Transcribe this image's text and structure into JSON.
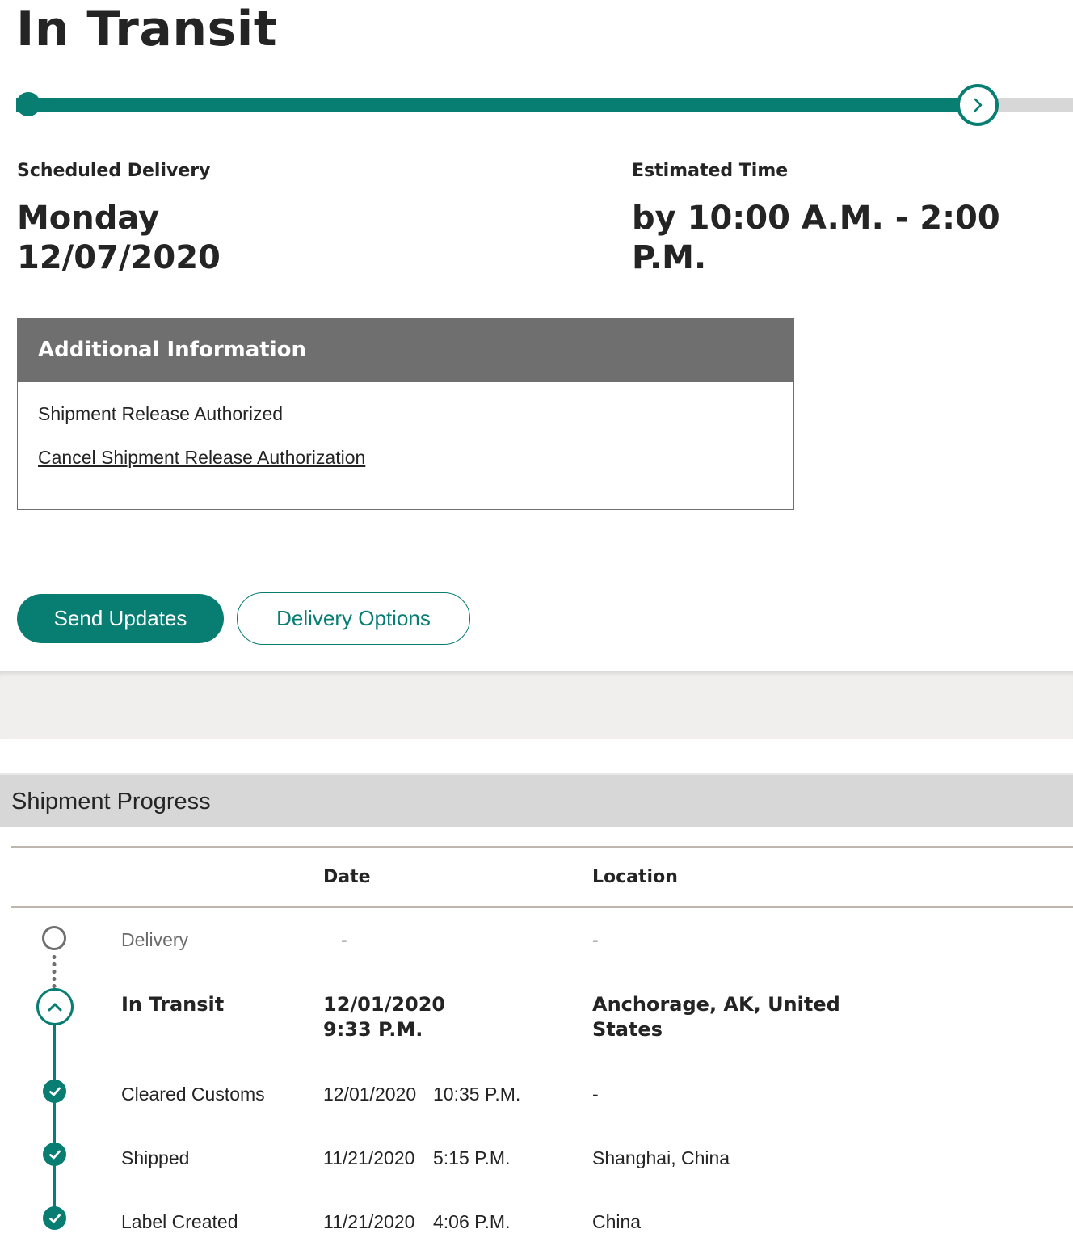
{
  "status": {
    "title": "In Transit",
    "progress_fraction": 0.91
  },
  "schedule": {
    "scheduled_label": "Scheduled Delivery",
    "day": "Monday",
    "date": "12/07/2020",
    "estimated_label": "Estimated Time",
    "estimated_value": "by 10:00 A.M. - 2:00 P.M."
  },
  "additional_info": {
    "heading": "Additional Information",
    "text": "Shipment Release Authorized",
    "link": "Cancel Shipment Release Authorization"
  },
  "actions": {
    "send_updates": "Send Updates",
    "delivery_options": "Delivery Options"
  },
  "shipment_progress": {
    "heading": "Shipment Progress",
    "columns": {
      "date": "Date",
      "location": "Location"
    },
    "rows": [
      {
        "status": "Delivery",
        "date": "-",
        "time": "",
        "location": "-",
        "state": "pending"
      },
      {
        "status": "In Transit",
        "date": "12/01/2020",
        "time": "9:33 P.M.",
        "location_line1": "Anchorage, AK, United",
        "location_line2": "States",
        "state": "current"
      },
      {
        "status": "Cleared Customs",
        "date": "12/01/2020",
        "time": "10:35 P.M.",
        "location": "-",
        "state": "done"
      },
      {
        "status": "Shipped",
        "date": "11/21/2020",
        "time": "5:15 P.M.",
        "location": "Shanghai, China",
        "state": "done"
      },
      {
        "status": "Label Created",
        "date": "11/21/2020",
        "time": "4:06 P.M.",
        "location": "China",
        "state": "done"
      }
    ]
  },
  "colors": {
    "accent": "#087d72",
    "header_gray": "#6f6f6f",
    "band_gray": "#f0efed",
    "section_gray": "#d7d7d7"
  },
  "icons": {
    "progress_knob": "chevron-right-icon",
    "current_step": "chevron-up-icon",
    "done_step": "checkmark-icon",
    "pending_step": "empty-circle-icon"
  }
}
